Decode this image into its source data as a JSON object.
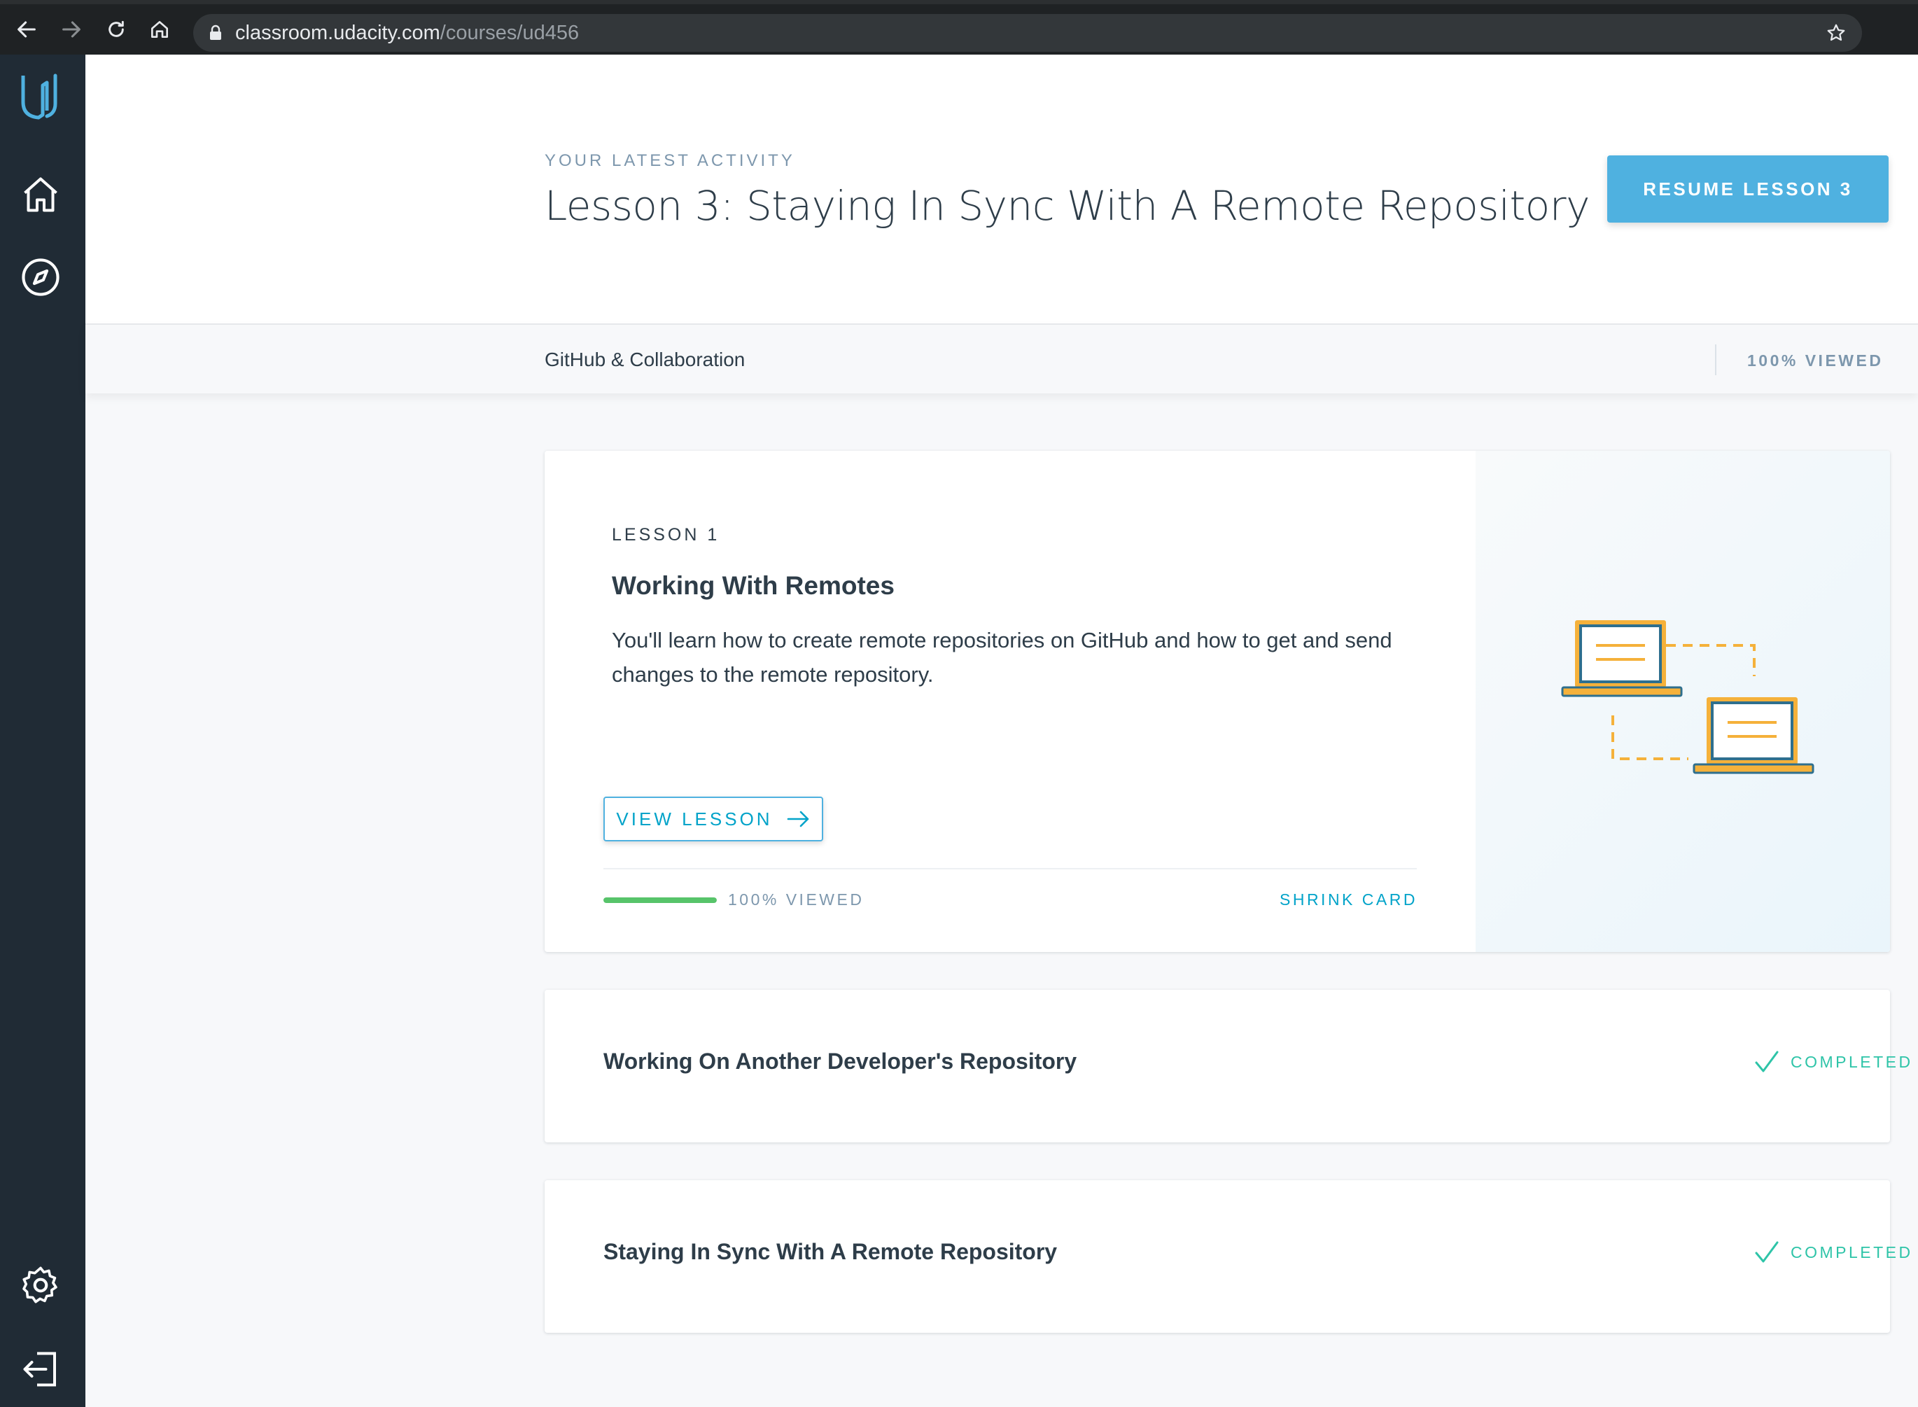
{
  "browser": {
    "url_host": "classroom.udacity.com",
    "url_path": "/courses/ud456"
  },
  "header": {
    "activity_label": "YOUR LATEST ACTIVITY",
    "activity_title": "Lesson 3: Staying In Sync With A Remote Repository",
    "resume_button": "RESUME LESSON 3"
  },
  "subheader": {
    "course_name": "GitHub & Collaboration",
    "viewed_label": "100% VIEWED"
  },
  "lessons": [
    {
      "number_label": "LESSON 1",
      "title": "Working With Remotes",
      "description": "You'll learn how to create remote repositories on GitHub and how to get and send changes to the remote repository.",
      "view_button": "VIEW LESSON",
      "progress": 1.0,
      "progress_label": "100% VIEWED",
      "shrink_label": "SHRINK CARD"
    },
    {
      "title": "Working On Another Developer's Repository",
      "status": "COMPLETED"
    },
    {
      "title": "Staying In Sync With A Remote Repository",
      "status": "COMPLETED"
    }
  ],
  "icons": {
    "sidebar": [
      "udacity-logo-icon",
      "home-icon",
      "compass-icon",
      "settings-icon",
      "logout-icon"
    ],
    "browser": [
      "back-icon",
      "forward-icon",
      "reload-icon",
      "home-icon",
      "lock-icon",
      "star-icon"
    ]
  },
  "colors": {
    "accent": "#4fb1e0",
    "link": "#02a3c9",
    "progress": "#57c46a",
    "completed": "#2ec4a8",
    "sidebar_bg": "#202b35",
    "text": "#2e3d49"
  }
}
